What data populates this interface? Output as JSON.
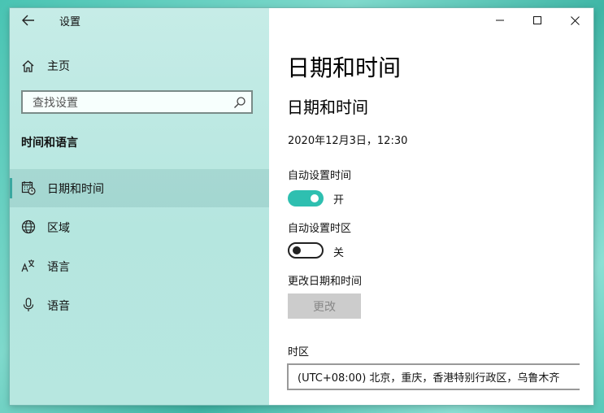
{
  "app": {
    "title": "设置"
  },
  "sidebar": {
    "home_label": "主页",
    "search_placeholder": "查找设置",
    "section_heading": "时间和语言",
    "items": [
      {
        "label": "日期和时间",
        "icon": "calendar-clock-icon",
        "selected": true
      },
      {
        "label": "区域",
        "icon": "globe-icon",
        "selected": false
      },
      {
        "label": "语言",
        "icon": "language-icon",
        "selected": false
      },
      {
        "label": "语音",
        "icon": "microphone-icon",
        "selected": false
      }
    ]
  },
  "main": {
    "page_title": "日期和时间",
    "sub_title": "日期和时间",
    "current_datetime": "2020年12月3日，12:30",
    "auto_time": {
      "label": "自动设置时间",
      "state_label": "开",
      "on": true
    },
    "auto_timezone": {
      "label": "自动设置时区",
      "state_label": "关",
      "on": false
    },
    "change_datetime": {
      "label": "更改日期和时间",
      "button_label": "更改"
    },
    "timezone": {
      "label": "时区",
      "value": "(UTC+08:00) 北京，重庆，香港特别行政区，乌鲁木齐"
    }
  },
  "colors": {
    "accent": "#2ebfb0",
    "sidebar_bg": "#c6ece7"
  }
}
